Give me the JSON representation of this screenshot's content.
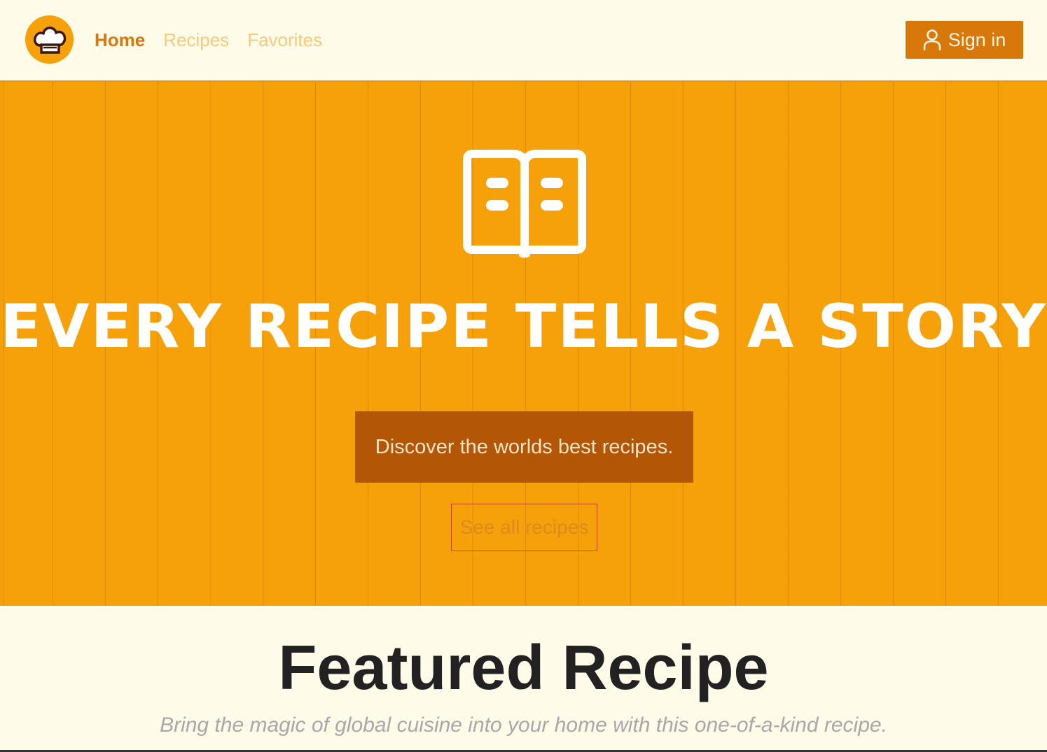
{
  "header": {
    "nav": [
      {
        "label": "Home",
        "active": true
      },
      {
        "label": "Recipes",
        "active": false
      },
      {
        "label": "Favorites",
        "active": false
      }
    ],
    "signin_label": "Sign in"
  },
  "hero": {
    "title": "EVERY RECIPE TELLS A STORY",
    "tagline": "Discover the worlds best recipes.",
    "cta_label": "See all recipes"
  },
  "featured": {
    "title": "Featured Recipe",
    "subtitle": "Bring the magic of global cuisine into your home with this one-of-a-kind recipe."
  },
  "colors": {
    "brand_orange": "#f6a10a",
    "accent_dark_orange": "#d8770a",
    "tagline_bg": "#b35606",
    "page_bg": "#fffbe9"
  },
  "icons": {
    "logo": "chef-hat-icon",
    "signin": "user-icon",
    "hero": "open-book-icon"
  }
}
